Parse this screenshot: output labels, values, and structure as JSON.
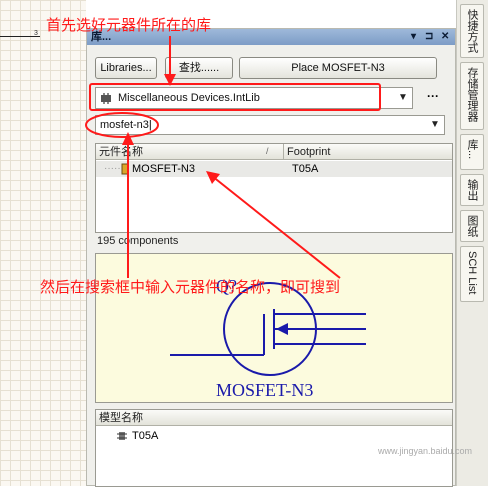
{
  "schematic": {
    "tick_label": "3"
  },
  "panel": {
    "title": "库...",
    "title_buttons": [
      "▾",
      "⊐",
      "✕"
    ],
    "libraries_button": "Libraries...",
    "search_button": "查找......",
    "place_button": "Place MOSFET-N3",
    "library_select": "Miscellaneous Devices.IntLib",
    "library_more": "···",
    "filter_value": "mosfet-n3",
    "columns": [
      "元件名称",
      "Footprint"
    ],
    "components": [
      {
        "name": "MOSFET-N3",
        "footprint": "T05A"
      }
    ],
    "count_text": "195 components",
    "preview": {
      "designator": "Q?",
      "part_label": "MOSFET-N3"
    },
    "model_header": "模型名称",
    "models": [
      "T05A"
    ]
  },
  "right_tabs": [
    "快捷方式",
    "存储管理器",
    "库...",
    "输出",
    "图纸",
    "SCH List"
  ],
  "annotations": {
    "step1": "首先选好元器件所在的库",
    "step2": "然后在搜索框中输入元器件的名称，即可搜到"
  },
  "watermark": "www.jingyan.baidu.com",
  "colors": {
    "annotation": "#ff1a1a",
    "symbol": "#1a1aaa",
    "titlebar": "#7d9cc6"
  }
}
